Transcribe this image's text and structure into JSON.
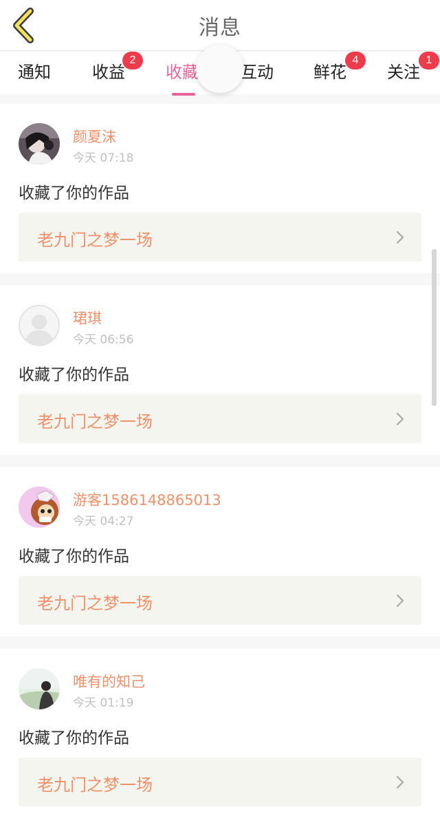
{
  "header": {
    "title": "消息",
    "back_icon": "chevron-left-icon"
  },
  "tabs": [
    {
      "label": "通知",
      "badge": ""
    },
    {
      "label": "收益",
      "badge": "2"
    },
    {
      "label": "收藏",
      "badge": ""
    },
    {
      "label": "互动",
      "badge": ""
    },
    {
      "label": "鲜花",
      "badge": "4"
    },
    {
      "label": "关注",
      "badge": "1"
    }
  ],
  "active_tab": "收藏",
  "colors": {
    "accent": "#e8649a",
    "badge": "#ee3c4c",
    "name": "#f0906a",
    "link_bg": "#f5f5ef"
  },
  "messages": [
    {
      "username": "颜夏沫",
      "time": "今天 07:18",
      "action": "收藏了你的作品",
      "work_title": "老九门之梦一场",
      "avatar": "user-avatar-image"
    },
    {
      "username": "珺琪",
      "time": "今天 06:56",
      "action": "收藏了你的作品",
      "work_title": "老九门之梦一场",
      "avatar": "default-avatar-icon"
    },
    {
      "username": "游客1586148865013",
      "time": "今天 04:27",
      "action": "收藏了你的作品",
      "work_title": "老九门之梦一场",
      "avatar": "user-avatar-image"
    },
    {
      "username": "唯有的知己",
      "time": "今天 01:19",
      "action": "收藏了你的作品",
      "work_title": "老九门之梦一场",
      "avatar": "user-avatar-image"
    }
  ]
}
